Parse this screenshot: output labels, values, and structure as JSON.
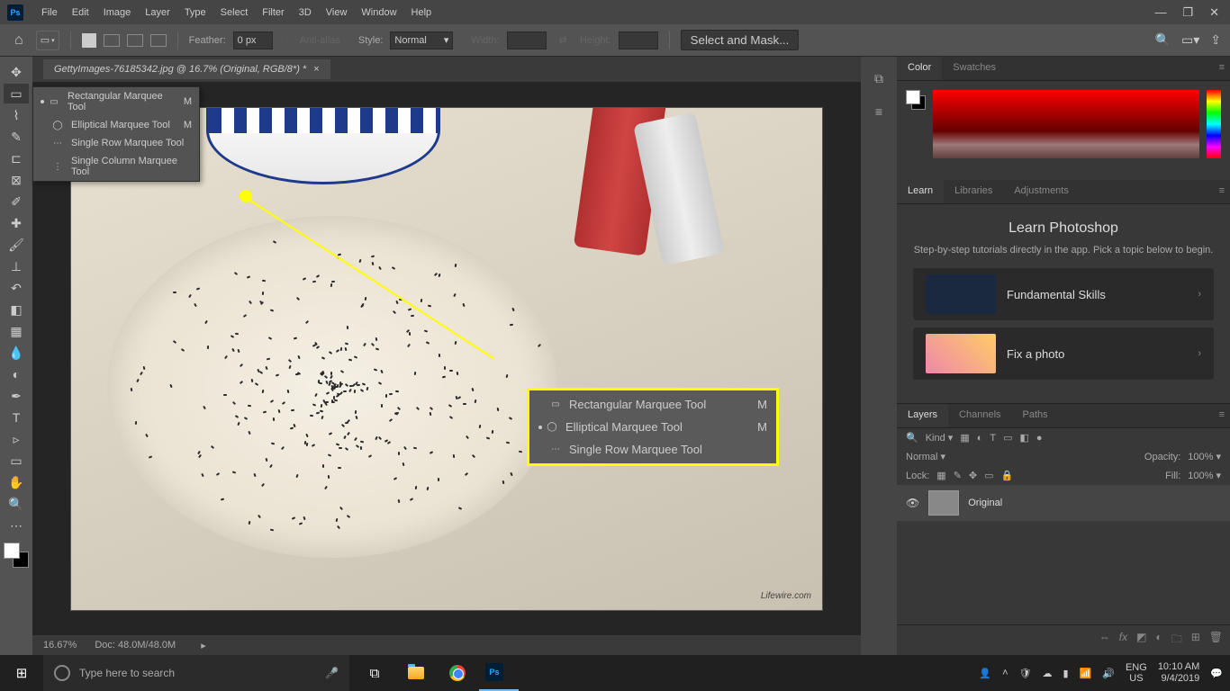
{
  "menubar": [
    "File",
    "Edit",
    "Image",
    "Layer",
    "Type",
    "Select",
    "Filter",
    "3D",
    "View",
    "Window",
    "Help"
  ],
  "options": {
    "feather_label": "Feather:",
    "feather_value": "0 px",
    "anti_alias": "Anti-alias",
    "style_label": "Style:",
    "style_value": "Normal",
    "width_label": "Width:",
    "height_label": "Height:",
    "select_mask": "Select and Mask..."
  },
  "doc_tab": "GettyImages-76185342.jpg @ 16.7% (Original, RGB/8*) *",
  "flyout": [
    {
      "label": "Rectangular Marquee Tool",
      "key": "M",
      "icon": "▭",
      "active": true
    },
    {
      "label": "Elliptical Marquee Tool",
      "key": "M",
      "icon": "◯"
    },
    {
      "label": "Single Row Marquee Tool",
      "key": "",
      "icon": "⋯"
    },
    {
      "label": "Single Column Marquee Tool",
      "key": "",
      "icon": "⋮"
    }
  ],
  "callout": [
    {
      "label": "Rectangular Marquee Tool",
      "key": "M",
      "icon": "▭"
    },
    {
      "label": "Elliptical Marquee Tool",
      "key": "M",
      "icon": "◯",
      "active": true
    },
    {
      "label": "Single Row Marquee Tool",
      "key": "",
      "icon": "⋯"
    }
  ],
  "status": {
    "zoom": "16.67%",
    "doc": "Doc: 48.0M/48.0M"
  },
  "watermark": "Lifewire.com",
  "color_tabs": [
    "Color",
    "Swatches"
  ],
  "learn_tabs": [
    "Learn",
    "Libraries",
    "Adjustments"
  ],
  "learn": {
    "title": "Learn Photoshop",
    "sub": "Step-by-step tutorials directly in the app. Pick a topic below to begin.",
    "card1": "Fundamental Skills",
    "card2": "Fix a photo"
  },
  "layers_tabs": [
    "Layers",
    "Channels",
    "Paths"
  ],
  "layers": {
    "kind": "Kind",
    "blend": "Normal",
    "opacity_label": "Opacity:",
    "opacity": "100%",
    "lock_label": "Lock:",
    "fill_label": "Fill:",
    "fill": "100%",
    "layer_name": "Original"
  },
  "taskbar": {
    "search_ph": "Type here to search",
    "lang": "ENG",
    "locale": "US",
    "time": "10:10 AM",
    "date": "9/4/2019"
  }
}
